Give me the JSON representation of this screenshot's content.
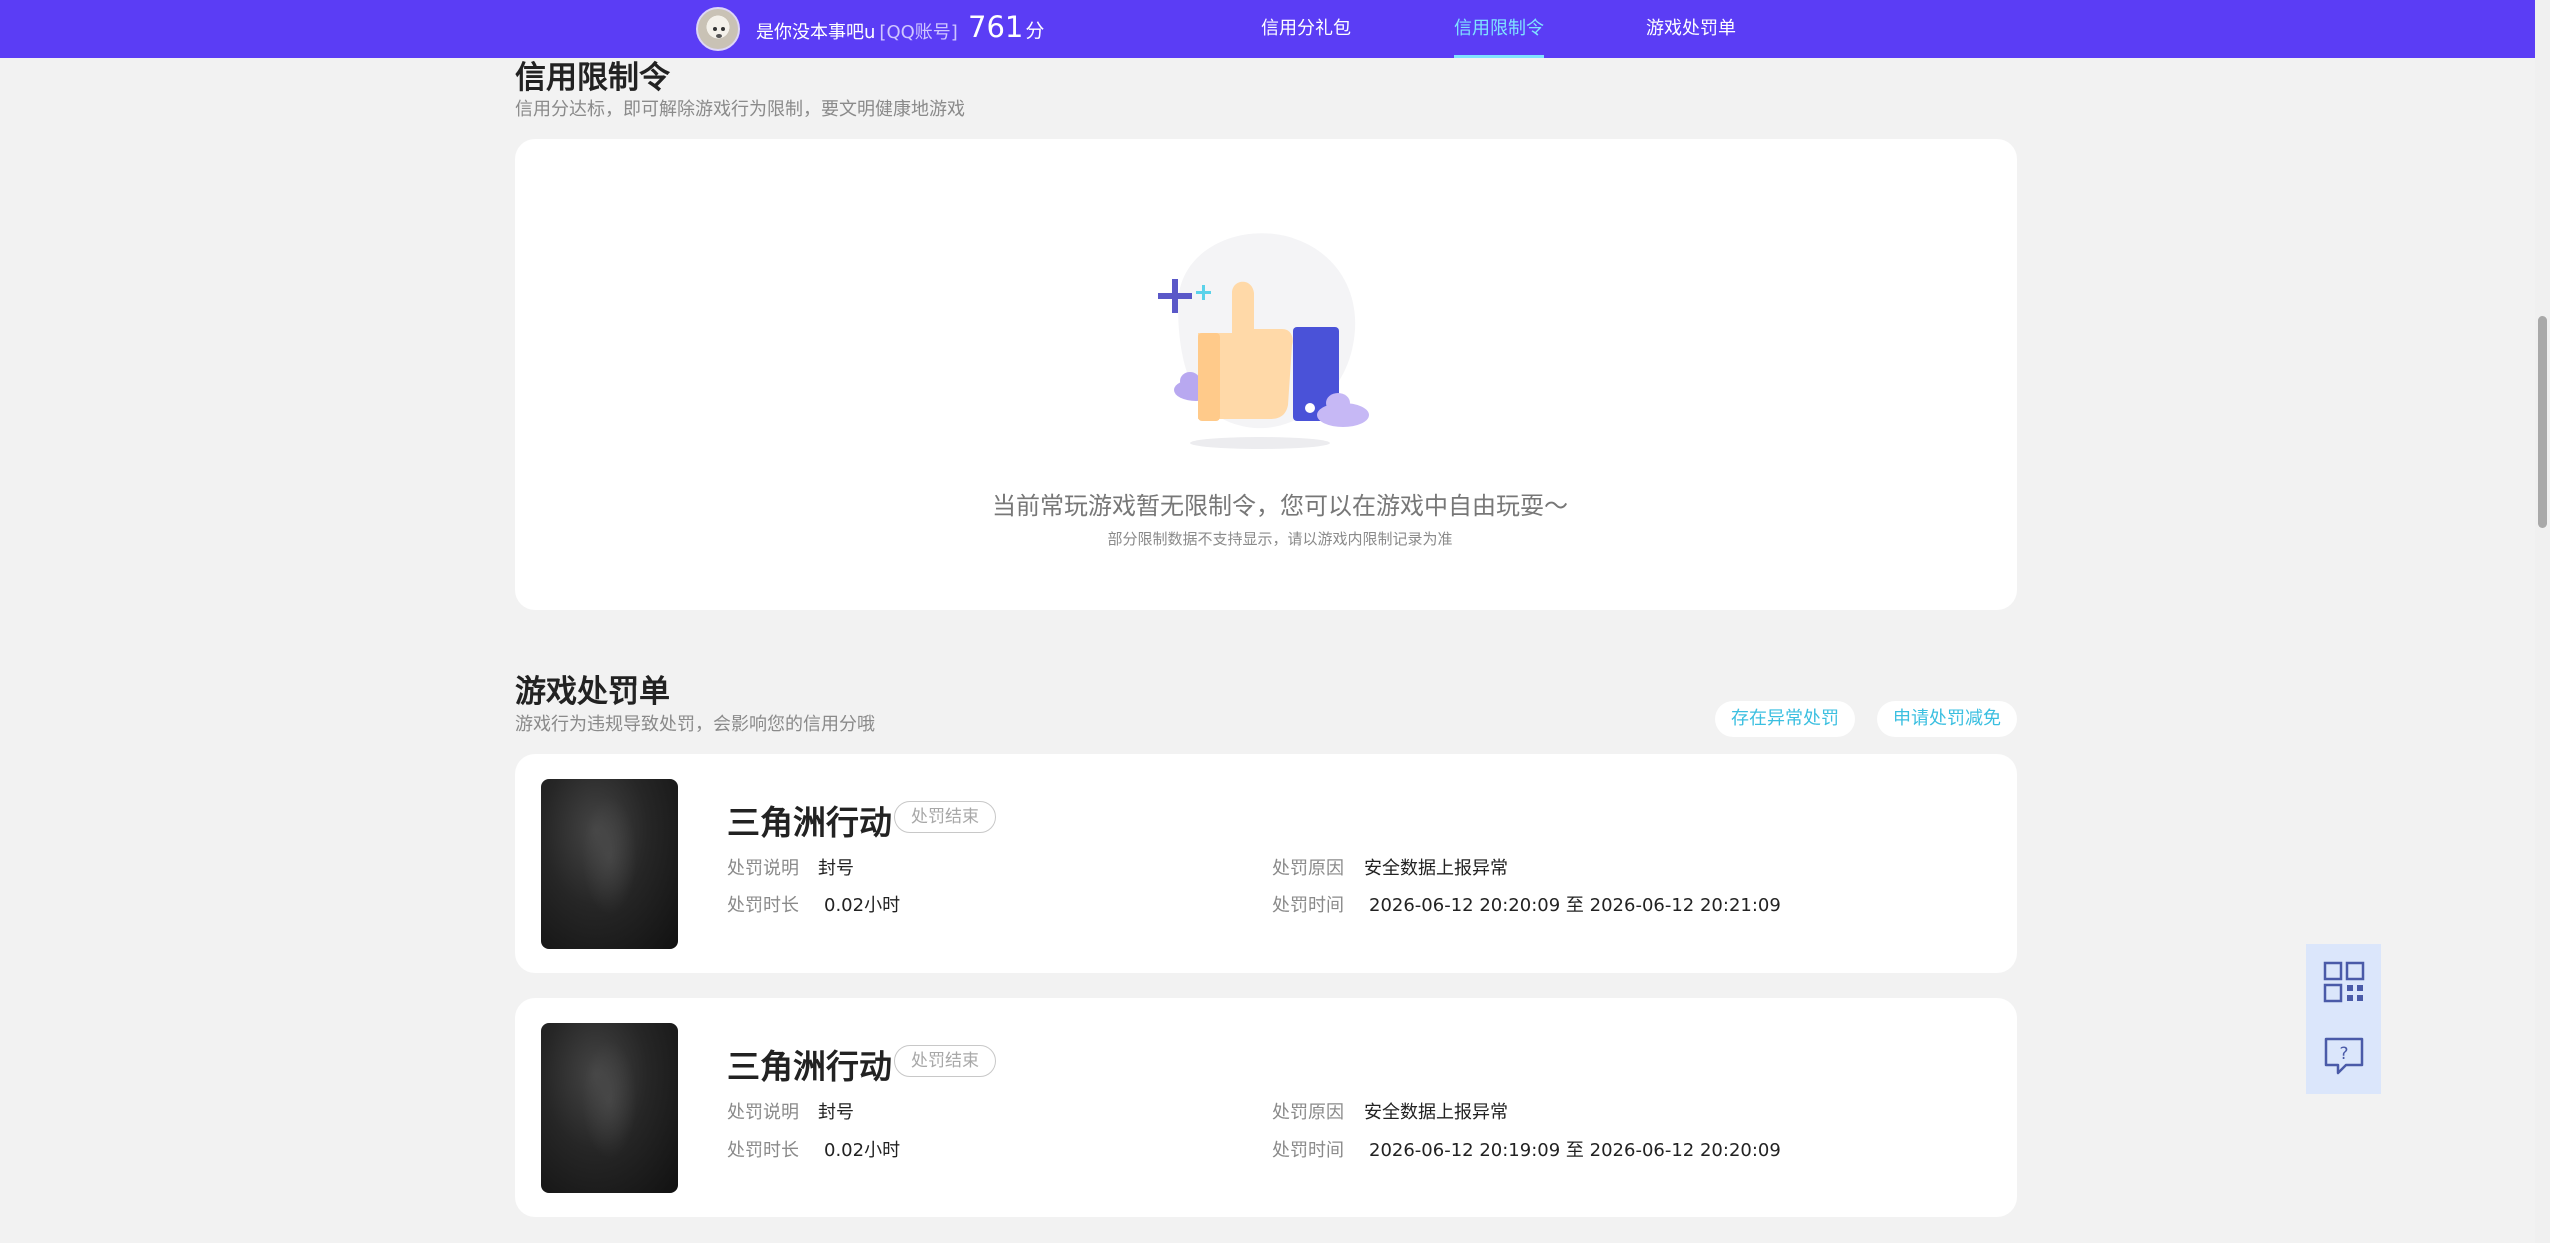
{
  "header": {
    "username": "是你没本事吧u",
    "account_type": "[QQ账号]",
    "score": "761",
    "score_unit": "分",
    "nav": [
      {
        "label": "信用分礼包",
        "active": false
      },
      {
        "label": "信用限制令",
        "active": true
      },
      {
        "label": "游戏处罚单",
        "active": false
      }
    ]
  },
  "restriction": {
    "title": "信用限制令",
    "subtitle": "信用分达标，即可解除游戏行为限制，要文明健康地游戏",
    "empty_message": "当前常玩游戏暂无限制令，您可以在游戏中自由玩耍～",
    "empty_note": "部分限制数据不支持显示，请以游戏内限制记录为准"
  },
  "penalties": {
    "title": "游戏处罚单",
    "subtitle": "游戏行为违规导致处罚，会影响您的信用分哦",
    "buttons": {
      "abnormal": "存在异常处罚",
      "appeal": "申请处罚减免"
    },
    "labels": {
      "desc": "处罚说明",
      "duration": "处罚时长",
      "reason": "处罚原因",
      "time": "处罚时间"
    },
    "records": [
      {
        "game": "三角洲行动",
        "status": "处罚结束",
        "desc": "封号",
        "duration": "0.02小时",
        "reason": "安全数据上报异常",
        "time_start": "2026-06-12 20:20:09",
        "time_sep": "至",
        "time_end": "2026-06-12 20:21:09"
      },
      {
        "game": "三角洲行动",
        "status": "处罚结束",
        "desc": "封号",
        "duration": "0.02小时",
        "reason": "安全数据上报异常",
        "time_start": "2026-06-12 20:19:09",
        "time_sep": "至",
        "time_end": "2026-06-12 20:20:09"
      }
    ]
  },
  "floating": [
    {
      "icon": "qr-code-icon"
    },
    {
      "icon": "feedback-help-icon"
    }
  ],
  "colors": {
    "header_bg": "#5b3df5",
    "active_nav": "#7fe3ff",
    "accent_link": "#3bbfe0",
    "float_bg": "#dbe6fb"
  }
}
